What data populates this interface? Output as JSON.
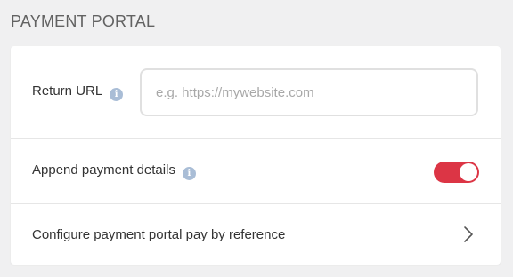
{
  "section": {
    "title": "PAYMENT PORTAL"
  },
  "return_url": {
    "label": "Return URL",
    "info_icon": "info-icon",
    "value": "",
    "placeholder": "e.g. https://mywebsite.com"
  },
  "append_details": {
    "label": "Append payment details",
    "info_icon": "info-icon",
    "toggle_on": true,
    "toggle_color": "#dc3545"
  },
  "configure": {
    "label": "Configure payment portal pay by reference",
    "icon": "chevron-right-icon"
  }
}
